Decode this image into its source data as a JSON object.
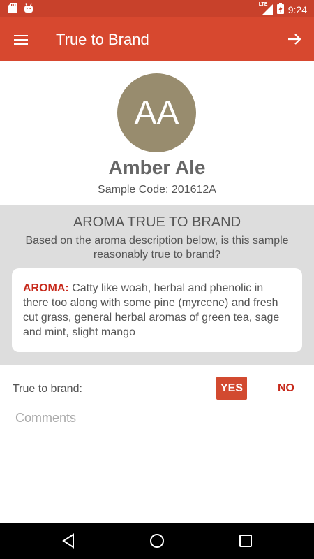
{
  "status_bar": {
    "time": "9:24",
    "network": "LTE",
    "icons": [
      "sd-card-icon",
      "android-icon",
      "signal-icon",
      "battery-icon"
    ]
  },
  "app_bar": {
    "title": "True to Brand",
    "menu_icon": "menu-icon",
    "next_icon": "arrow-right-icon"
  },
  "profile": {
    "initials": "AA",
    "name": "Amber Ale",
    "sample_code": "Sample Code: 201612A"
  },
  "aroma": {
    "title": "AROMA TRUE TO BRAND",
    "question": "Based on the aroma description below, is this sample reasonably true to brand?",
    "label": "AROMA:",
    "description": "Catty like woah, herbal and phenolic in there too along with some pine (myrcene) and fresh cut grass, general herbal aromas of green tea, sage and mint, slight mango"
  },
  "true_to_brand": {
    "label": "True to brand:",
    "yes_label": "YES",
    "no_label": "NO"
  },
  "comments": {
    "placeholder": "Comments",
    "value": ""
  },
  "colors": {
    "app_bar": "#d7482f",
    "status_bar": "#c8412b",
    "accent": "#c7291b",
    "avatar": "#988c6e"
  }
}
